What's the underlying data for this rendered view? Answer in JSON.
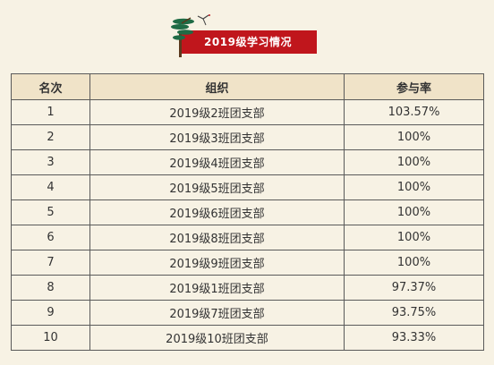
{
  "banner": {
    "title": "2019级学习情况",
    "colors": {
      "bar": "#c0161c",
      "tree": "#1f6b45",
      "trunk": "#5b3a1e"
    },
    "icon": "pine-tree-and-crane-icon"
  },
  "table": {
    "headers": [
      "名次",
      "组织",
      "参与率"
    ],
    "rows": [
      {
        "rank": "1",
        "org": "2019级2班团支部",
        "rate": "103.57%"
      },
      {
        "rank": "2",
        "org": "2019级3班团支部",
        "rate": "100%"
      },
      {
        "rank": "3",
        "org": "2019级4班团支部",
        "rate": "100%"
      },
      {
        "rank": "4",
        "org": "2019级5班团支部",
        "rate": "100%"
      },
      {
        "rank": "5",
        "org": "2019级6班团支部",
        "rate": "100%"
      },
      {
        "rank": "6",
        "org": "2019级8班团支部",
        "rate": "100%"
      },
      {
        "rank": "7",
        "org": "2019级9班团支部",
        "rate": "100%"
      },
      {
        "rank": "8",
        "org": "2019级1班团支部",
        "rate": "97.37%"
      },
      {
        "rank": "9",
        "org": "2019级7班团支部",
        "rate": "93.75%"
      },
      {
        "rank": "10",
        "org": "2019级10班团支部",
        "rate": "93.33%"
      }
    ],
    "colors": {
      "header_bg": "#f0e3c8",
      "page_bg": "#f7f2e4",
      "border": "#5a5a5a"
    }
  }
}
